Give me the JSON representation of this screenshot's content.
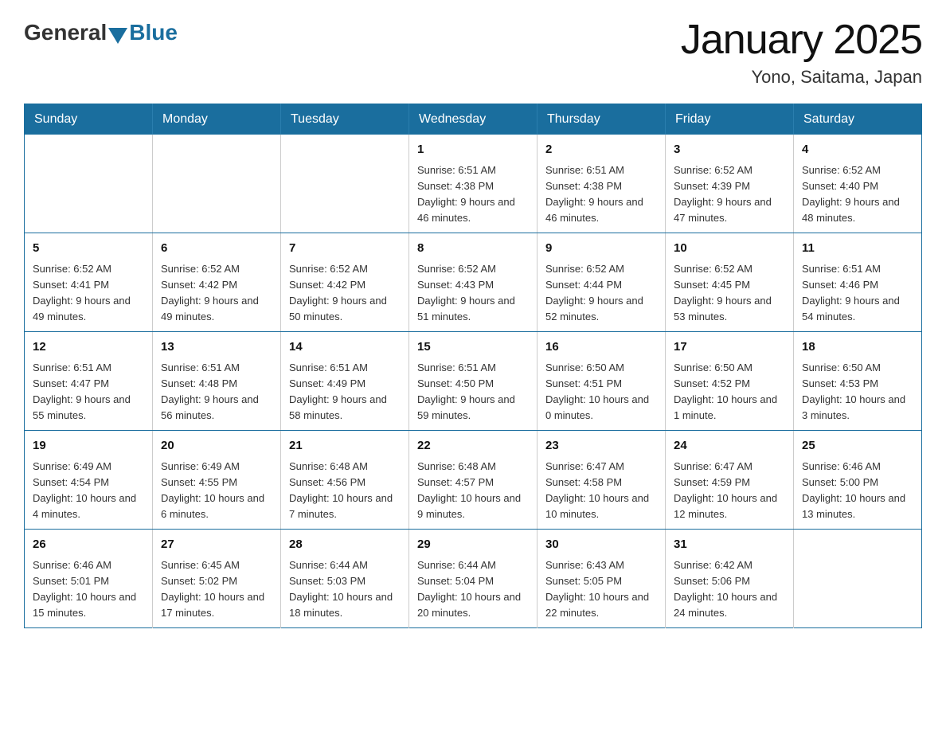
{
  "header": {
    "logo": {
      "general": "General",
      "blue": "Blue"
    },
    "title": "January 2025",
    "location": "Yono, Saitama, Japan"
  },
  "weekdays": [
    "Sunday",
    "Monday",
    "Tuesday",
    "Wednesday",
    "Thursday",
    "Friday",
    "Saturday"
  ],
  "weeks": [
    [
      {
        "day": "",
        "info": ""
      },
      {
        "day": "",
        "info": ""
      },
      {
        "day": "",
        "info": ""
      },
      {
        "day": "1",
        "info": "Sunrise: 6:51 AM\nSunset: 4:38 PM\nDaylight: 9 hours and 46 minutes."
      },
      {
        "day": "2",
        "info": "Sunrise: 6:51 AM\nSunset: 4:38 PM\nDaylight: 9 hours and 46 minutes."
      },
      {
        "day": "3",
        "info": "Sunrise: 6:52 AM\nSunset: 4:39 PM\nDaylight: 9 hours and 47 minutes."
      },
      {
        "day": "4",
        "info": "Sunrise: 6:52 AM\nSunset: 4:40 PM\nDaylight: 9 hours and 48 minutes."
      }
    ],
    [
      {
        "day": "5",
        "info": "Sunrise: 6:52 AM\nSunset: 4:41 PM\nDaylight: 9 hours and 49 minutes."
      },
      {
        "day": "6",
        "info": "Sunrise: 6:52 AM\nSunset: 4:42 PM\nDaylight: 9 hours and 49 minutes."
      },
      {
        "day": "7",
        "info": "Sunrise: 6:52 AM\nSunset: 4:42 PM\nDaylight: 9 hours and 50 minutes."
      },
      {
        "day": "8",
        "info": "Sunrise: 6:52 AM\nSunset: 4:43 PM\nDaylight: 9 hours and 51 minutes."
      },
      {
        "day": "9",
        "info": "Sunrise: 6:52 AM\nSunset: 4:44 PM\nDaylight: 9 hours and 52 minutes."
      },
      {
        "day": "10",
        "info": "Sunrise: 6:52 AM\nSunset: 4:45 PM\nDaylight: 9 hours and 53 minutes."
      },
      {
        "day": "11",
        "info": "Sunrise: 6:51 AM\nSunset: 4:46 PM\nDaylight: 9 hours and 54 minutes."
      }
    ],
    [
      {
        "day": "12",
        "info": "Sunrise: 6:51 AM\nSunset: 4:47 PM\nDaylight: 9 hours and 55 minutes."
      },
      {
        "day": "13",
        "info": "Sunrise: 6:51 AM\nSunset: 4:48 PM\nDaylight: 9 hours and 56 minutes."
      },
      {
        "day": "14",
        "info": "Sunrise: 6:51 AM\nSunset: 4:49 PM\nDaylight: 9 hours and 58 minutes."
      },
      {
        "day": "15",
        "info": "Sunrise: 6:51 AM\nSunset: 4:50 PM\nDaylight: 9 hours and 59 minutes."
      },
      {
        "day": "16",
        "info": "Sunrise: 6:50 AM\nSunset: 4:51 PM\nDaylight: 10 hours and 0 minutes."
      },
      {
        "day": "17",
        "info": "Sunrise: 6:50 AM\nSunset: 4:52 PM\nDaylight: 10 hours and 1 minute."
      },
      {
        "day": "18",
        "info": "Sunrise: 6:50 AM\nSunset: 4:53 PM\nDaylight: 10 hours and 3 minutes."
      }
    ],
    [
      {
        "day": "19",
        "info": "Sunrise: 6:49 AM\nSunset: 4:54 PM\nDaylight: 10 hours and 4 minutes."
      },
      {
        "day": "20",
        "info": "Sunrise: 6:49 AM\nSunset: 4:55 PM\nDaylight: 10 hours and 6 minutes."
      },
      {
        "day": "21",
        "info": "Sunrise: 6:48 AM\nSunset: 4:56 PM\nDaylight: 10 hours and 7 minutes."
      },
      {
        "day": "22",
        "info": "Sunrise: 6:48 AM\nSunset: 4:57 PM\nDaylight: 10 hours and 9 minutes."
      },
      {
        "day": "23",
        "info": "Sunrise: 6:47 AM\nSunset: 4:58 PM\nDaylight: 10 hours and 10 minutes."
      },
      {
        "day": "24",
        "info": "Sunrise: 6:47 AM\nSunset: 4:59 PM\nDaylight: 10 hours and 12 minutes."
      },
      {
        "day": "25",
        "info": "Sunrise: 6:46 AM\nSunset: 5:00 PM\nDaylight: 10 hours and 13 minutes."
      }
    ],
    [
      {
        "day": "26",
        "info": "Sunrise: 6:46 AM\nSunset: 5:01 PM\nDaylight: 10 hours and 15 minutes."
      },
      {
        "day": "27",
        "info": "Sunrise: 6:45 AM\nSunset: 5:02 PM\nDaylight: 10 hours and 17 minutes."
      },
      {
        "day": "28",
        "info": "Sunrise: 6:44 AM\nSunset: 5:03 PM\nDaylight: 10 hours and 18 minutes."
      },
      {
        "day": "29",
        "info": "Sunrise: 6:44 AM\nSunset: 5:04 PM\nDaylight: 10 hours and 20 minutes."
      },
      {
        "day": "30",
        "info": "Sunrise: 6:43 AM\nSunset: 5:05 PM\nDaylight: 10 hours and 22 minutes."
      },
      {
        "day": "31",
        "info": "Sunrise: 6:42 AM\nSunset: 5:06 PM\nDaylight: 10 hours and 24 minutes."
      },
      {
        "day": "",
        "info": ""
      }
    ]
  ]
}
